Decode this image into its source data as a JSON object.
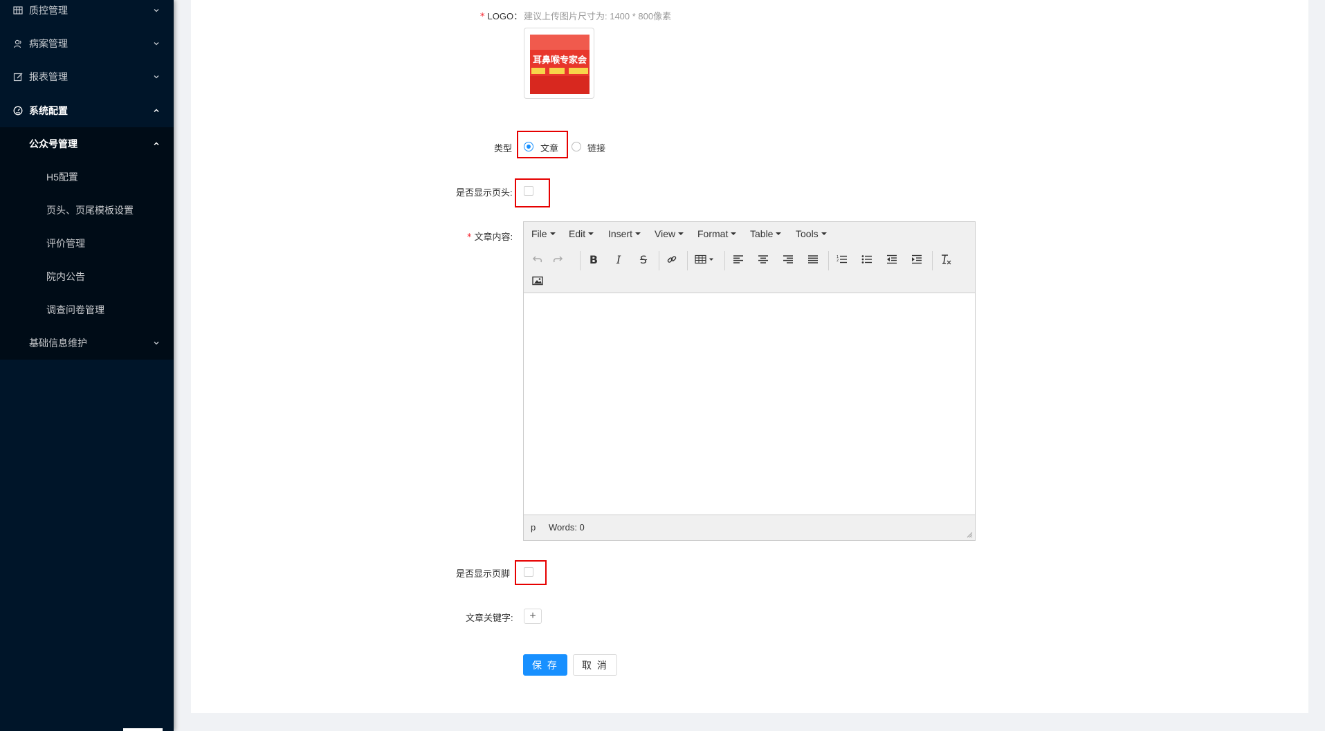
{
  "sidebar": {
    "items": [
      {
        "label": "质控管理",
        "icon": "table-icon"
      },
      {
        "label": "病案管理",
        "icon": "users-icon"
      },
      {
        "label": "报表管理",
        "icon": "edit-icon"
      },
      {
        "label": "系统配置",
        "icon": "dashboard-icon"
      }
    ],
    "submenu": {
      "label": "公众号管理",
      "children": [
        "H5配置",
        "页头、页尾模板设置",
        "评价管理",
        "院内公告",
        "调查问卷管理"
      ]
    },
    "submenu2": {
      "label": "基础信息维护"
    }
  },
  "form": {
    "logo_label": "LOGO：",
    "logo_hint": "建议上传图片尺寸为: 1400 * 800像素",
    "logo_image_text": "耳鼻喉专家会",
    "type_label": "类型",
    "type_options": [
      "文章",
      "链接"
    ],
    "type_selected": "文章",
    "show_header_label": "是否显示页头:",
    "show_header_checked": false,
    "content_label": "文章内容:",
    "show_footer_label": "是否显示页脚",
    "show_footer_checked": false,
    "keywords_label": "文章关键字:",
    "add_symbol": "+",
    "save_label": "保 存",
    "cancel_label": "取 消"
  },
  "editor": {
    "menus": [
      "File",
      "Edit",
      "Insert",
      "View",
      "Format",
      "Table",
      "Tools"
    ],
    "status_path": "p",
    "word_count": "Words: 0"
  }
}
